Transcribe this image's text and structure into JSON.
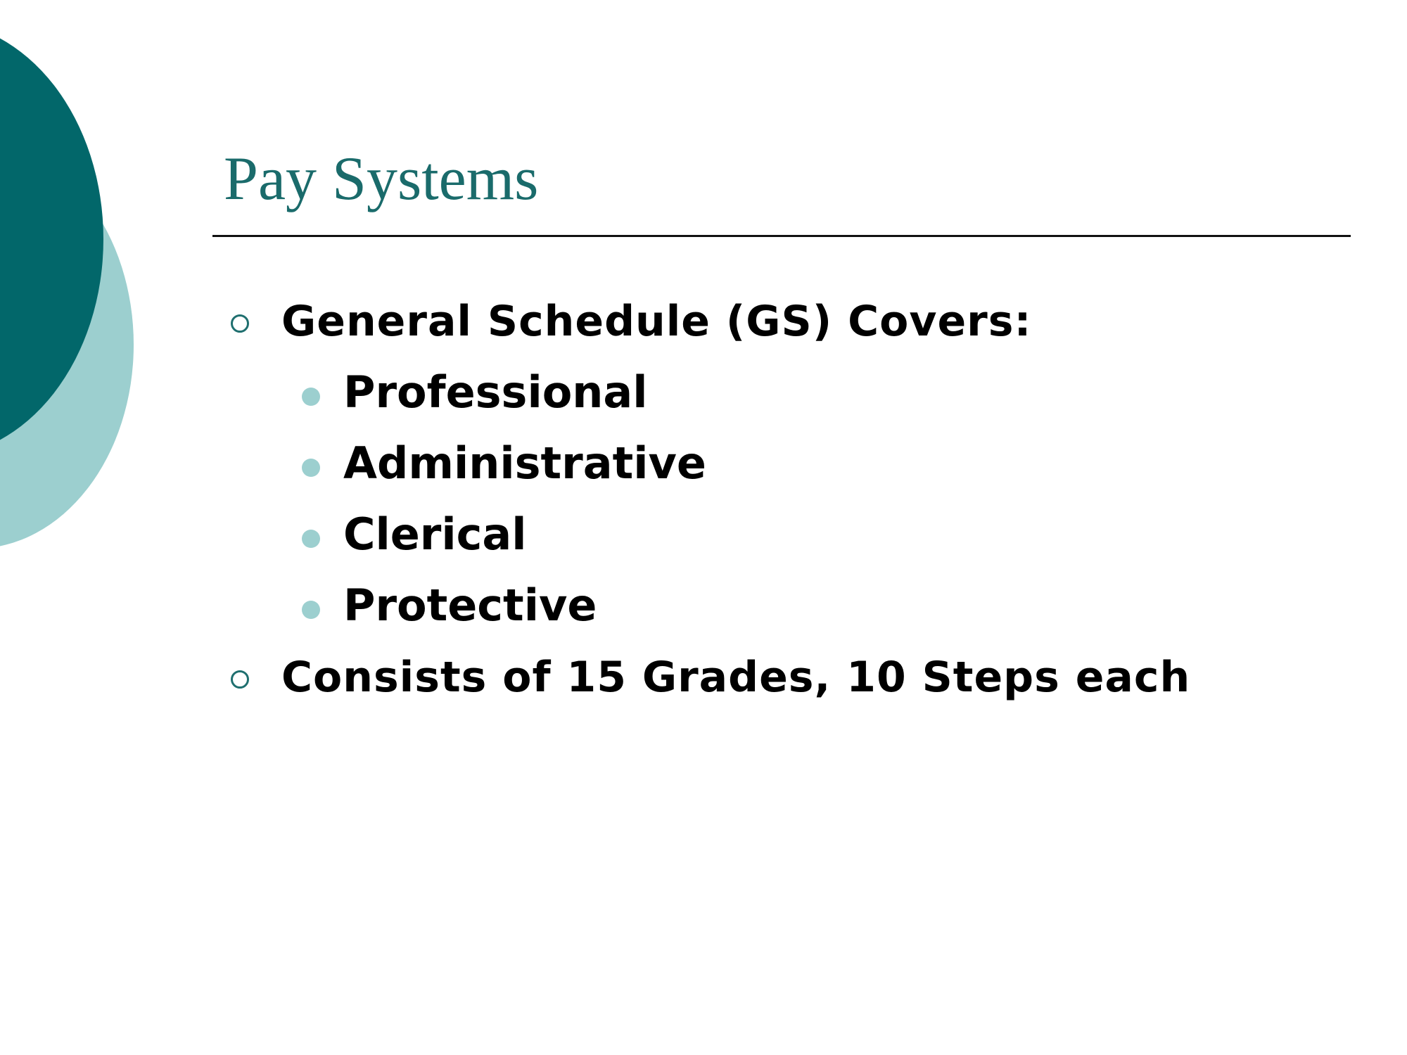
{
  "slide": {
    "title": "Pay Systems",
    "bullets": [
      {
        "text": "General Schedule (GS) Covers:",
        "level": 1
      },
      {
        "text": "Professional",
        "level": 2
      },
      {
        "text": "Administrative",
        "level": 2
      },
      {
        "text": "Clerical",
        "level": 2
      },
      {
        "text": "Protective",
        "level": 2
      },
      {
        "text": "Consists of 15 Grades, 10 Steps each",
        "level": 1
      }
    ]
  },
  "colors": {
    "dark_teal": "#02676a",
    "light_teal": "#9ccfcf",
    "title_teal": "#1a6b6b"
  },
  "icons": {
    "level1_bullet": "hollow-circle-icon",
    "level2_bullet": "filled-dot-icon"
  }
}
